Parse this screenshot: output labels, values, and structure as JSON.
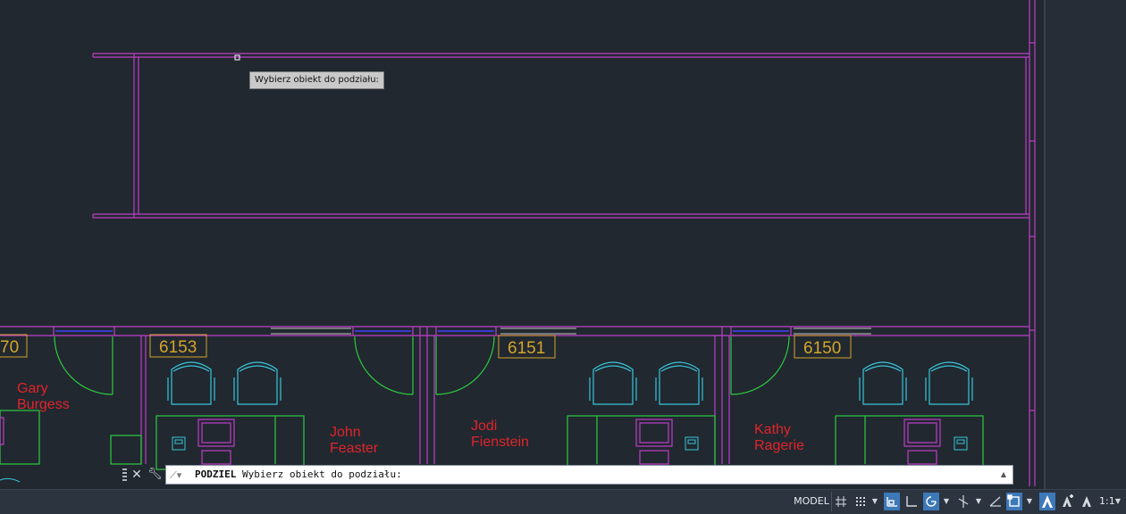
{
  "tooltip": {
    "text": "Wybierz obiekt do podziału:"
  },
  "command_line": {
    "command": "PODZIEL",
    "prompt": "Wybierz obiekt do podziału:"
  },
  "rooms": [
    {
      "number": "70",
      "occupant_line1": "Gary",
      "occupant_line2": "Burgess"
    },
    {
      "number": "6153",
      "occupant_line1": "John",
      "occupant_line2": "Feaster"
    },
    {
      "number": "6151",
      "occupant_line1": "Jodi",
      "occupant_line2": "Fienstein"
    },
    {
      "number": "6150",
      "occupant_line1": "Kathy",
      "occupant_line2": "Ragerie"
    }
  ],
  "status_bar": {
    "model_label": "MODEL",
    "scale_label": "1:1",
    "icons": [
      "grid-icon",
      "snap-icon",
      "infer-constraints-icon",
      "ortho-icon",
      "polar-tracking-icon",
      "isodraft-icon",
      "object-snap-tracking-icon",
      "2d-object-snap-icon",
      "annotation-visibility-icon",
      "autoscale-icon",
      "annotation-scale-icon"
    ]
  },
  "colors": {
    "background": "#212830",
    "walls": "#c03ec8",
    "doors": "#2ecc40",
    "furniture": "#38c6d9",
    "room_tags": "#d4a52a",
    "names": "#e0242a",
    "windows": "#3a3ad0",
    "statusbar_active": "#3d78b8"
  }
}
